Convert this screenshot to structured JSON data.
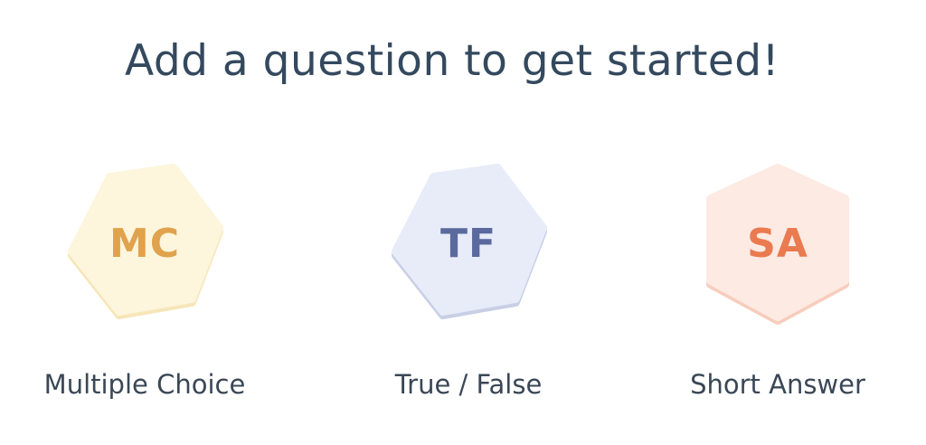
{
  "heading": "Add a question to get started!",
  "options": [
    {
      "badge": "MC",
      "label": "Multiple Choice",
      "fill": "#fdf5dc",
      "edge": "#f6e6b8",
      "text_color": "#e0a24c"
    },
    {
      "badge": "TF",
      "label": "True / False",
      "fill": "#e8ecf8",
      "edge": "#c8cfe6",
      "text_color": "#5a6a9e"
    },
    {
      "badge": "SA",
      "label": "Short Answer",
      "fill": "#fdeae3",
      "edge": "#f7cdbd",
      "text_color": "#ea7a4f"
    }
  ]
}
